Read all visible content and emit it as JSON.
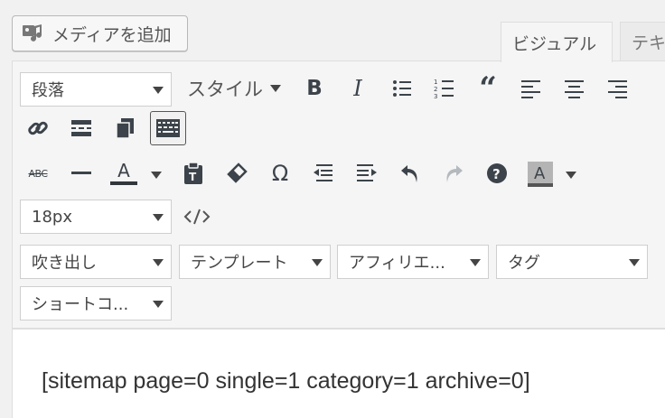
{
  "media_button": {
    "label": "メディアを追加"
  },
  "tabs": [
    {
      "label": "ビジュアル"
    },
    {
      "label": "テキ"
    }
  ],
  "row1": {
    "paragraph_select": "段落",
    "style_dropdown": "スタイル"
  },
  "row2": {
    "font_size_select": "18px"
  },
  "row3": {
    "selects": [
      "吹き出し",
      "テンプレート",
      "アフィリエ...",
      "タグ",
      "ショートコ..."
    ]
  },
  "editor": {
    "content": "[sitemap page=0 single=1 category=1 archive=0]"
  },
  "icons": [
    "media-icon",
    "bold-icon",
    "italic-icon",
    "bullet-list-icon",
    "numbered-list-icon",
    "blockquote-icon",
    "align-left-icon",
    "align-center-icon",
    "align-right-icon",
    "link-icon",
    "read-more-icon",
    "copy-icon",
    "keyboard-icon",
    "strikethrough-icon",
    "horizontal-line-icon",
    "text-color-icon",
    "paste-text-icon",
    "clear-formatting-icon",
    "special-character-icon",
    "outdent-icon",
    "indent-icon",
    "undo-icon",
    "redo-icon",
    "help-icon",
    "background-color-icon",
    "code-icon"
  ],
  "colors": {
    "text_color_bar": "#32373c",
    "bg_color_bar": "#555555",
    "redo_disabled": "#b4b9be"
  }
}
